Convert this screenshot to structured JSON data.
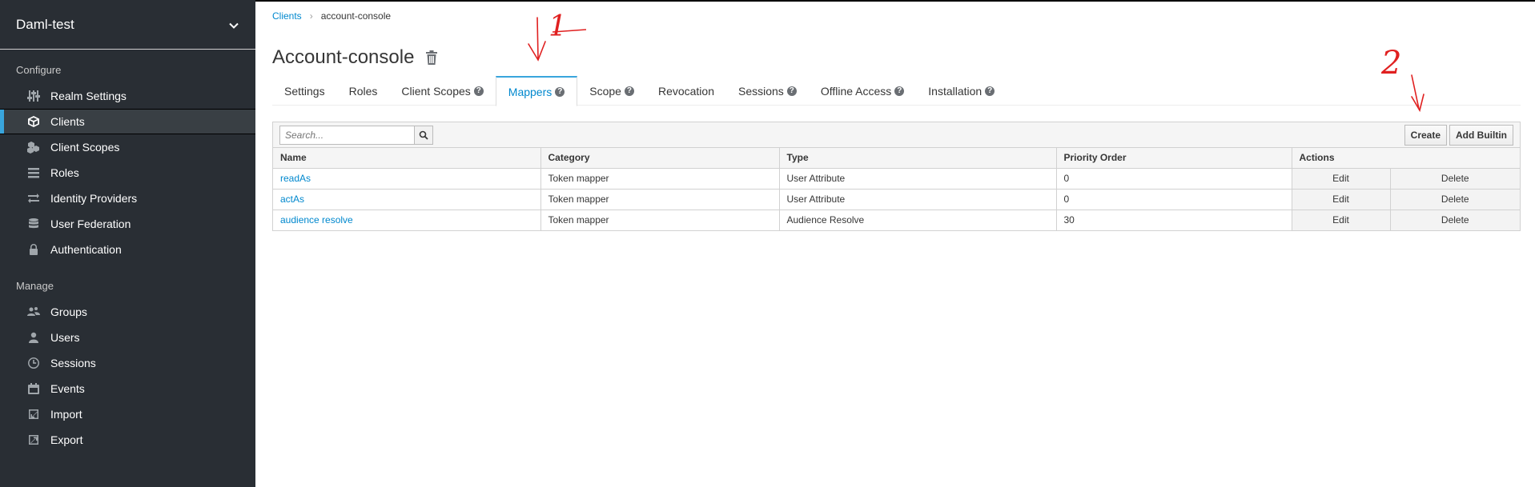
{
  "sidebar": {
    "realm": "Daml-test",
    "configure_title": "Configure",
    "manage_title": "Manage",
    "configure_items": [
      {
        "label": "Realm Settings",
        "icon": "sliders-icon"
      },
      {
        "label": "Clients",
        "icon": "cube-icon",
        "active": true
      },
      {
        "label": "Client Scopes",
        "icon": "cubes-icon"
      },
      {
        "label": "Roles",
        "icon": "list-icon"
      },
      {
        "label": "Identity Providers",
        "icon": "exchange-icon"
      },
      {
        "label": "User Federation",
        "icon": "database-icon"
      },
      {
        "label": "Authentication",
        "icon": "lock-icon"
      }
    ],
    "manage_items": [
      {
        "label": "Groups",
        "icon": "users-icon"
      },
      {
        "label": "Users",
        "icon": "user-icon"
      },
      {
        "label": "Sessions",
        "icon": "clock-icon"
      },
      {
        "label": "Events",
        "icon": "calendar-icon"
      },
      {
        "label": "Import",
        "icon": "import-icon"
      },
      {
        "label": "Export",
        "icon": "export-icon"
      }
    ]
  },
  "breadcrumb": {
    "link": "Clients",
    "separator": "›",
    "current": "account-console"
  },
  "page": {
    "title": "Account-console"
  },
  "tabs": [
    {
      "label": "Settings",
      "help": false
    },
    {
      "label": "Roles",
      "help": false
    },
    {
      "label": "Client Scopes",
      "help": true
    },
    {
      "label": "Mappers",
      "help": true,
      "active": true
    },
    {
      "label": "Scope",
      "help": true
    },
    {
      "label": "Revocation",
      "help": false
    },
    {
      "label": "Sessions",
      "help": true
    },
    {
      "label": "Offline Access",
      "help": true
    },
    {
      "label": "Installation",
      "help": true
    }
  ],
  "toolbar": {
    "search_placeholder": "Search...",
    "create_label": "Create",
    "add_builtin_label": "Add Builtin"
  },
  "table": {
    "columns": [
      "Name",
      "Category",
      "Type",
      "Priority Order",
      "Actions"
    ],
    "rows": [
      {
        "name": "readAs",
        "category": "Token mapper",
        "type": "User Attribute",
        "priority": "0",
        "edit": "Edit",
        "delete": "Delete"
      },
      {
        "name": "actAs",
        "category": "Token mapper",
        "type": "User Attribute",
        "priority": "0",
        "edit": "Edit",
        "delete": "Delete"
      },
      {
        "name": "audience resolve",
        "category": "Token mapper",
        "type": "Audience Resolve",
        "priority": "30",
        "edit": "Edit",
        "delete": "Delete"
      }
    ]
  },
  "annotations": {
    "mark1": "1",
    "mark2": "2",
    "color": "#e02020"
  },
  "colors": {
    "sidebar_bg": "#292e34",
    "accent": "#39a5dc",
    "link": "#0088ce"
  }
}
